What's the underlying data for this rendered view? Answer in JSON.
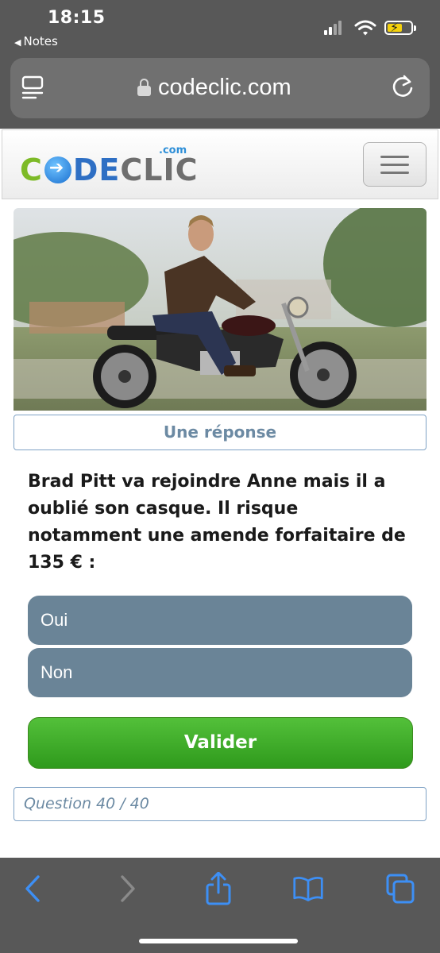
{
  "status_bar": {
    "time": "18:15",
    "back_app": "Notes",
    "signal_icon": "cellular-signal-icon",
    "wifi_icon": "wifi-icon",
    "battery_icon": "battery-charging-icon",
    "battery_color": "#f4d10c"
  },
  "browser": {
    "url": "codeclic.com",
    "reader_icon": "reader-view-icon",
    "lock_icon": "lock-icon",
    "reload_icon": "reload-icon"
  },
  "site": {
    "logo": {
      "c": "C",
      "de": "DE",
      "clic": "CLIC",
      "tld": ".com",
      "colors": {
        "green": "#7dba27",
        "blue": "#2e6fc4",
        "gray": "#6e6e6e"
      }
    },
    "menu_icon": "hamburger-menu-icon"
  },
  "quiz": {
    "answer_toggle": "Une réponse",
    "question": "Brad Pitt va rejoindre Anne mais il a oublié son casque. Il risque notamment une amende forfaitaire de 135 € :",
    "choices": [
      "Oui",
      "Non"
    ],
    "choice_color": "#6a8497",
    "validate_label": "Valider",
    "validate_color": "#3aa524",
    "progress": "Question 40 / 40"
  },
  "toolbar": {
    "back_icon": "back-arrow-icon",
    "forward_icon": "forward-arrow-icon",
    "share_icon": "share-icon",
    "bookmarks_icon": "bookmarks-book-icon",
    "tabs_icon": "tabs-icon",
    "accent": "#3d8ff5"
  }
}
